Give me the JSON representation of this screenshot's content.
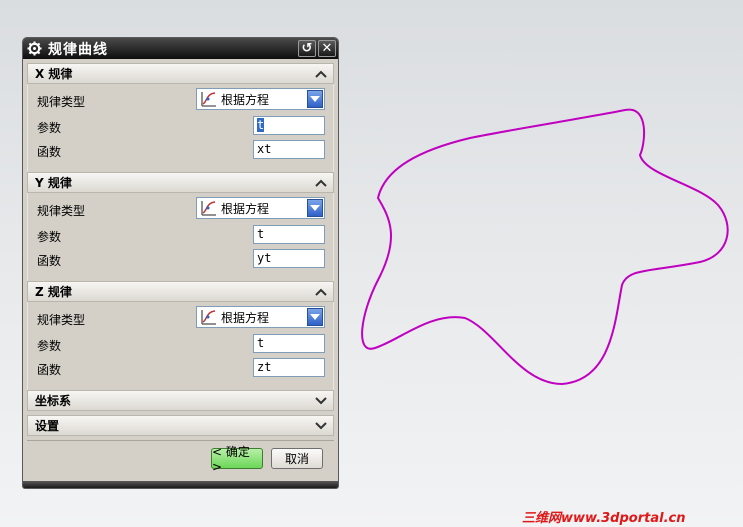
{
  "dialog": {
    "title": "规律曲线",
    "reset_glyph": "↺",
    "close_glyph": "✕"
  },
  "sections": {
    "x": {
      "header": "X 规律",
      "law_type_label": "规律类型",
      "law_type_value": "根据方程",
      "param_label": "参数",
      "param_value": "t",
      "func_label": "函数",
      "func_value": "xt"
    },
    "y": {
      "header": "Y 规律",
      "law_type_label": "规律类型",
      "law_type_value": "根据方程",
      "param_label": "参数",
      "param_value": "t",
      "func_label": "函数",
      "func_value": "yt"
    },
    "z": {
      "header": "Z 规律",
      "law_type_label": "规律类型",
      "law_type_value": "根据方程",
      "param_label": "参数",
      "param_value": "t",
      "func_label": "函数",
      "func_value": "zt"
    },
    "csys": {
      "header": "坐标系"
    },
    "settings": {
      "header": "设置"
    }
  },
  "buttons": {
    "ok": "< 确定 >",
    "cancel": "取消"
  },
  "watermark": "三维网www.3dportal.cn",
  "colors": {
    "curve": "#c000c0",
    "title_bar": "#1a1a1a",
    "ok_button": "#7ddc68",
    "dropdown_arrow": "#3a6fd0",
    "watermark": "#e01818"
  },
  "icons": [
    "gear-icon",
    "reset-icon",
    "close-icon",
    "chevron-up-icon",
    "chevron-down-icon",
    "law-curve-icon",
    "dropdown-arrow-icon"
  ]
}
